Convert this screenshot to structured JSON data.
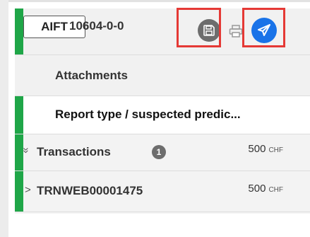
{
  "header": {
    "case_type": "AIFT",
    "case_id": "10604-0-0",
    "icons": {
      "save": "save-icon",
      "print": "print-icon",
      "send": "send-icon"
    },
    "accent_color": "#1fa648",
    "send_color": "#1a73e8",
    "highlight_color": "#e53935"
  },
  "items": {
    "attachments": {
      "label": "Attachments"
    },
    "report": {
      "label": "Report type / suspected predic..."
    },
    "transactions": {
      "chevron": "»",
      "label": "Transactions",
      "count": "1",
      "amount": "500",
      "currency": "CHF"
    },
    "transaction": {
      "chevron": ">",
      "label": "TRNWEB00001475",
      "amount": "500",
      "currency": "CHF"
    }
  }
}
